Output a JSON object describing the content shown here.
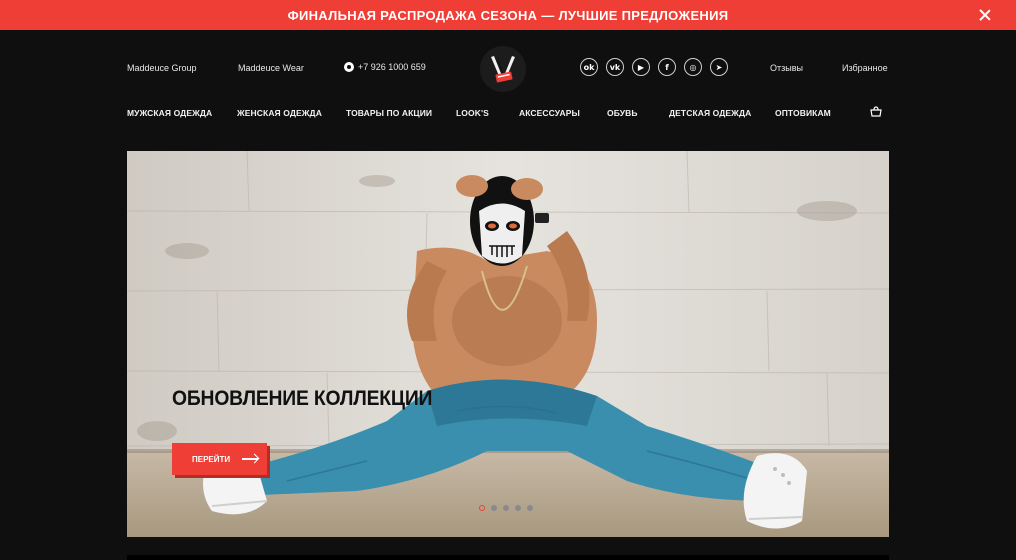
{
  "promo": {
    "text": "ФИНАЛЬНАЯ РАСПРОДАЖА СЕЗОНА — ЛУЧШИЕ ПРЕДЛОЖЕНИЯ",
    "accent": "#ef3e36"
  },
  "topbar": {
    "links_left": [
      "Maddeuce Group",
      "Maddeuce Wear"
    ],
    "phone": "+7 926 1000 659",
    "socials": [
      {
        "icon": "odnoklassniki-icon",
        "glyph": "ok"
      },
      {
        "icon": "vk-icon",
        "glyph": "vk"
      },
      {
        "icon": "youtube-icon",
        "glyph": "▶"
      },
      {
        "icon": "facebook-icon",
        "glyph": "f"
      },
      {
        "icon": "instagram-icon",
        "glyph": "◎"
      },
      {
        "icon": "telegram-icon",
        "glyph": "➤"
      }
    ],
    "reviews": "Отзывы",
    "favorites": "Избранное"
  },
  "nav": {
    "items": [
      "МУЖСКАЯ ОДЕЖДА",
      "ЖЕНСКАЯ ОДЕЖДА",
      "ТОВАРЫ ПО АКЦИИ",
      "LOOK'S",
      "АКСЕССУАРЫ",
      "ОБУВЬ",
      "ДЕТСКАЯ ОДЕЖДА",
      "ОПТОВИКАМ"
    ],
    "cart_icon": "cart-icon"
  },
  "hero": {
    "title": "ОБНОВЛЕНИЕ КОЛЛЕКЦИИ",
    "button": "ПЕРЕЙТИ",
    "slides_total": 5,
    "active_slide": 1
  }
}
